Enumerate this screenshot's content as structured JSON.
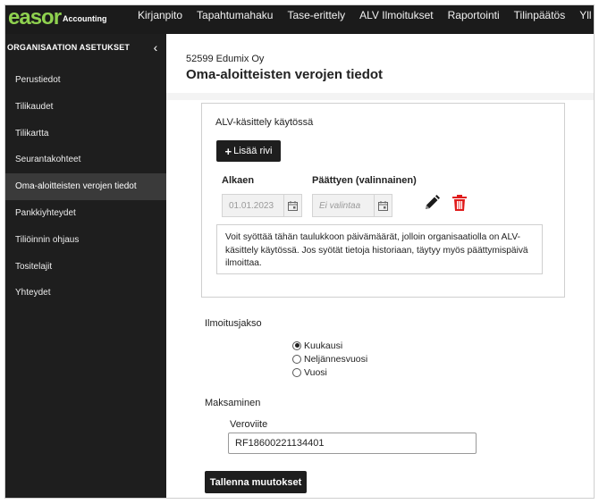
{
  "brand": {
    "logo": "easor",
    "product": "Accounting",
    "accent": "#8fd14f"
  },
  "nav": [
    {
      "label": "Kirjanpito"
    },
    {
      "label": "Tapahtumahaku"
    },
    {
      "label": "Tase-erittely"
    },
    {
      "label": "ALV Ilmoitukset"
    },
    {
      "label": "Raportointi"
    },
    {
      "label": "Tilinpäätös"
    },
    {
      "label": "Yll"
    }
  ],
  "sidebar": {
    "title": "ORGANISAATION ASETUKSET",
    "collapse_icon": "‹",
    "items": [
      {
        "label": "Perustiedot"
      },
      {
        "label": "Tilikaudet"
      },
      {
        "label": "Tilikartta"
      },
      {
        "label": "Seurantakohteet"
      },
      {
        "label": "Oma-aloitteisten verojen tiedot"
      },
      {
        "label": "Pankkiyhteydet"
      },
      {
        "label": "Tiliöinnin ohjaus"
      },
      {
        "label": "Tositelajit"
      },
      {
        "label": "Yhteydet"
      }
    ],
    "active_index": 4
  },
  "main": {
    "org": "52599 Edumix Oy",
    "title": "Oma-aloitteisten verojen tiedot",
    "vat_card": {
      "title": "ALV-käsittely käytössä",
      "add_button": {
        "plus": "+",
        "label": "Lisää rivi"
      },
      "columns": {
        "start": "Alkaen",
        "end": "Päättyen (valinnainen)"
      },
      "start_value": "01.01.2023",
      "end_placeholder": "Ei valintaa",
      "info": "Voit syöttää tähän taulukkoon päivämäärät, jolloin organisaatiolla on ALV-käsittely käytössä. Jos syötät tietoja historiaan, täytyy myös päättymispäivä ilmoittaa.",
      "icons": {
        "edit": "pencil-icon",
        "delete": "trash-icon",
        "delete_color": "#e01b1b"
      }
    },
    "period": {
      "label": "Ilmoitusjakso",
      "options": [
        {
          "label": "Kuukausi",
          "checked": true
        },
        {
          "label": "Neljännesvuosi",
          "checked": false
        },
        {
          "label": "Vuosi",
          "checked": false
        }
      ]
    },
    "payment": {
      "label": "Maksaminen",
      "ref_label": "Veroviite",
      "ref_value": "RF18600221134401"
    },
    "save_label": "Tallenna muutokset"
  }
}
